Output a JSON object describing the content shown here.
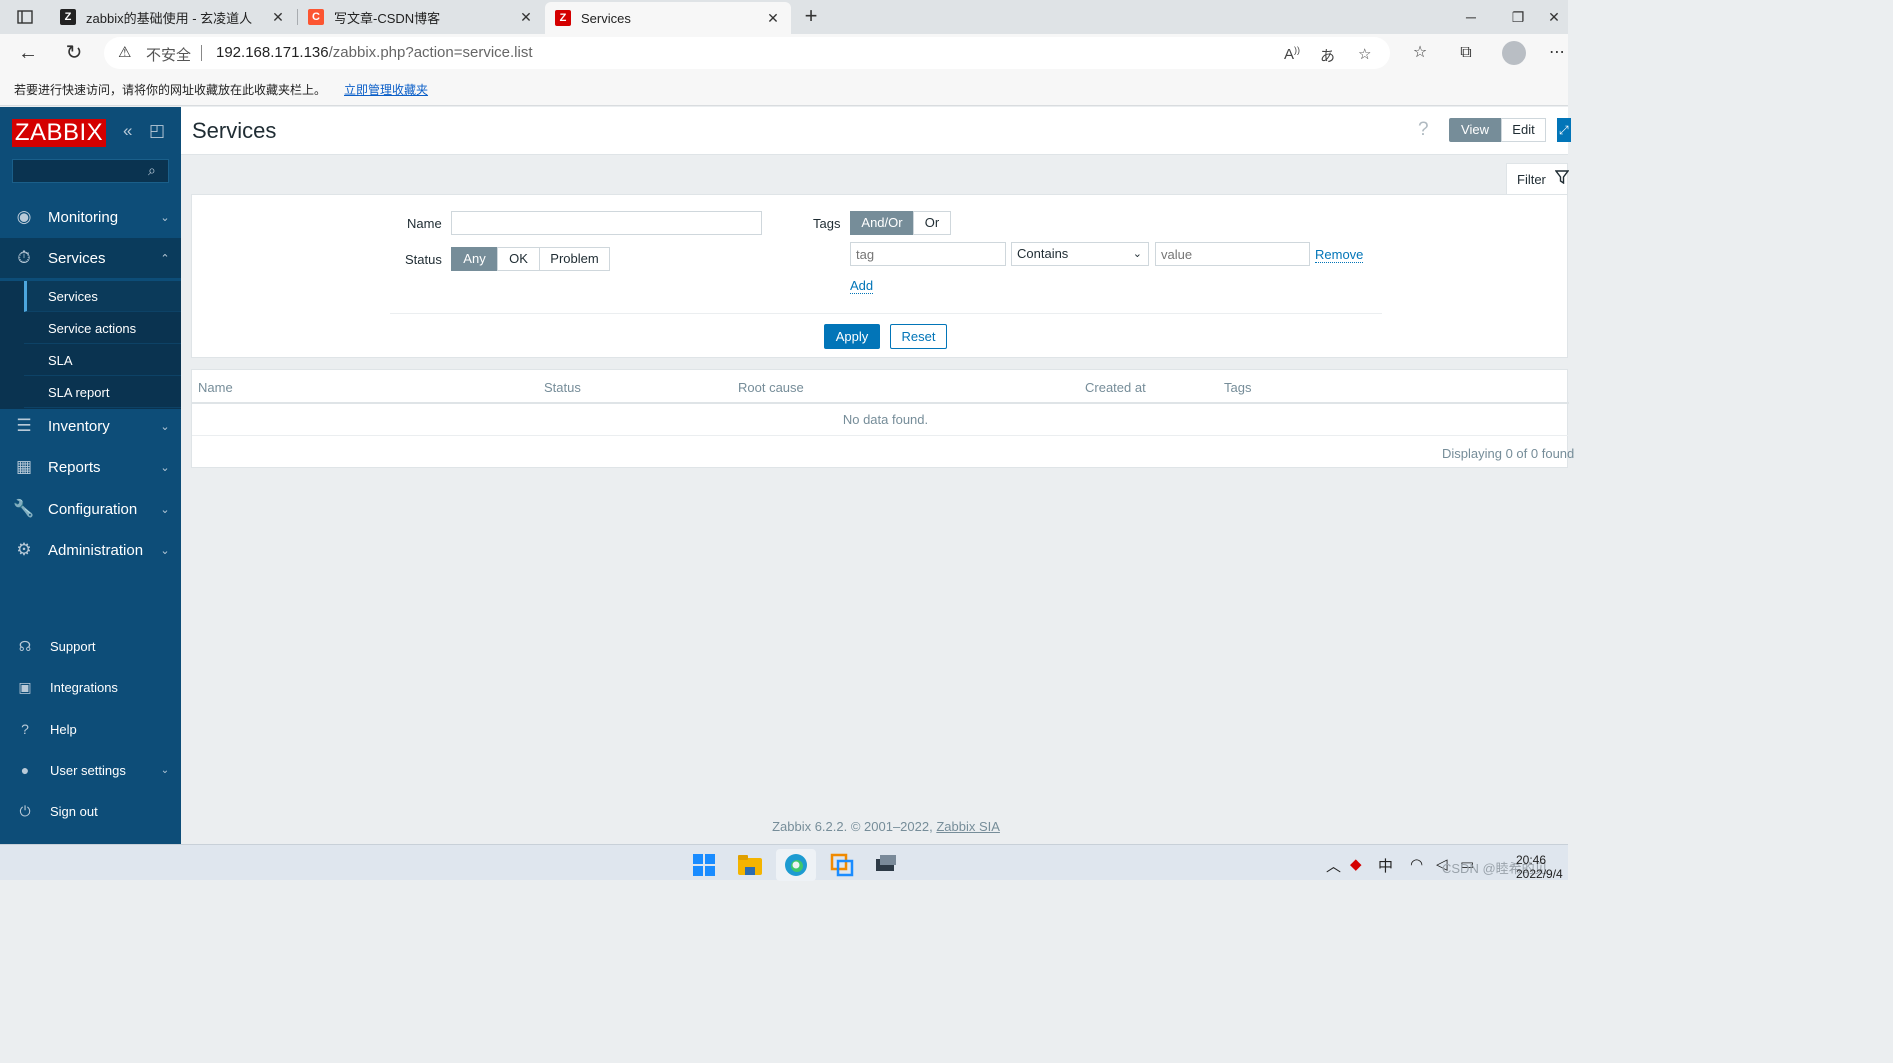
{
  "browser": {
    "tabs": [
      {
        "title": "zabbix的基础使用 - 玄凌道人",
        "icon": "zabbix-doc-icon"
      },
      {
        "title": "写文章-CSDN博客",
        "icon": "csdn-icon"
      },
      {
        "title": "Services",
        "icon": "zabbix-icon",
        "active": true
      }
    ],
    "insecure_label": "不安全",
    "url_host": "192.168.171.136",
    "url_path": "/zabbix.php?action=service.list",
    "favbar_message": "若要进行快速访问，请将你的网址收藏放在此收藏夹栏上。",
    "favbar_link": "立即管理收藏夹"
  },
  "sidebar": {
    "logo": "ZABBIX",
    "search_value": "",
    "menu": [
      {
        "label": "Monitoring",
        "icon": "eye-icon"
      },
      {
        "label": "Services",
        "icon": "stopwatch-icon",
        "open": true
      },
      {
        "label": "Inventory",
        "icon": "list-icon"
      },
      {
        "label": "Reports",
        "icon": "bar-chart-icon"
      },
      {
        "label": "Configuration",
        "icon": "wrench-icon"
      },
      {
        "label": "Administration",
        "icon": "gear-icon"
      }
    ],
    "submenu": [
      {
        "label": "Services",
        "selected": true
      },
      {
        "label": "Service actions"
      },
      {
        "label": "SLA"
      },
      {
        "label": "SLA report"
      }
    ],
    "bottom": [
      {
        "label": "Support",
        "icon": "headset-icon"
      },
      {
        "label": "Integrations",
        "icon": "integrations-icon"
      },
      {
        "label": "Help",
        "icon": "help-icon"
      },
      {
        "label": "User settings",
        "icon": "user-icon"
      },
      {
        "label": "Sign out",
        "icon": "power-icon"
      }
    ]
  },
  "header": {
    "title": "Services",
    "help": "?",
    "view_label": "View",
    "edit_label": "Edit"
  },
  "filter": {
    "tab_label": "Filter",
    "name_label": "Name",
    "name_value": "",
    "status_label": "Status",
    "status_options": [
      "Any",
      "OK",
      "Problem"
    ],
    "status_selected": "Any",
    "tags_label": "Tags",
    "tags_mode_options": [
      "And/Or",
      "Or"
    ],
    "tags_mode_selected": "And/Or",
    "tag_placeholder": "tag",
    "operator_selected": "Contains",
    "value_placeholder": "value",
    "remove_label": "Remove",
    "add_label": "Add",
    "apply_label": "Apply",
    "reset_label": "Reset"
  },
  "table": {
    "columns": [
      "Name",
      "Status",
      "Root cause",
      "Created at",
      "Tags"
    ],
    "empty_message": "No data found.",
    "displaying": "Displaying 0 of 0 found"
  },
  "footer": {
    "text": "Zabbix 6.2.2. © 2001–2022,",
    "link": "Zabbix SIA"
  },
  "taskbar": {
    "ime": "中",
    "time": "20:46",
    "date": "2022/9/4",
    "watermark": "CSDN @睦希的见"
  },
  "colors": {
    "sidebar": "#0d4d78",
    "logo": "#d40000",
    "primary_button": "#0275b8",
    "selected_toggle": "#768d99"
  }
}
